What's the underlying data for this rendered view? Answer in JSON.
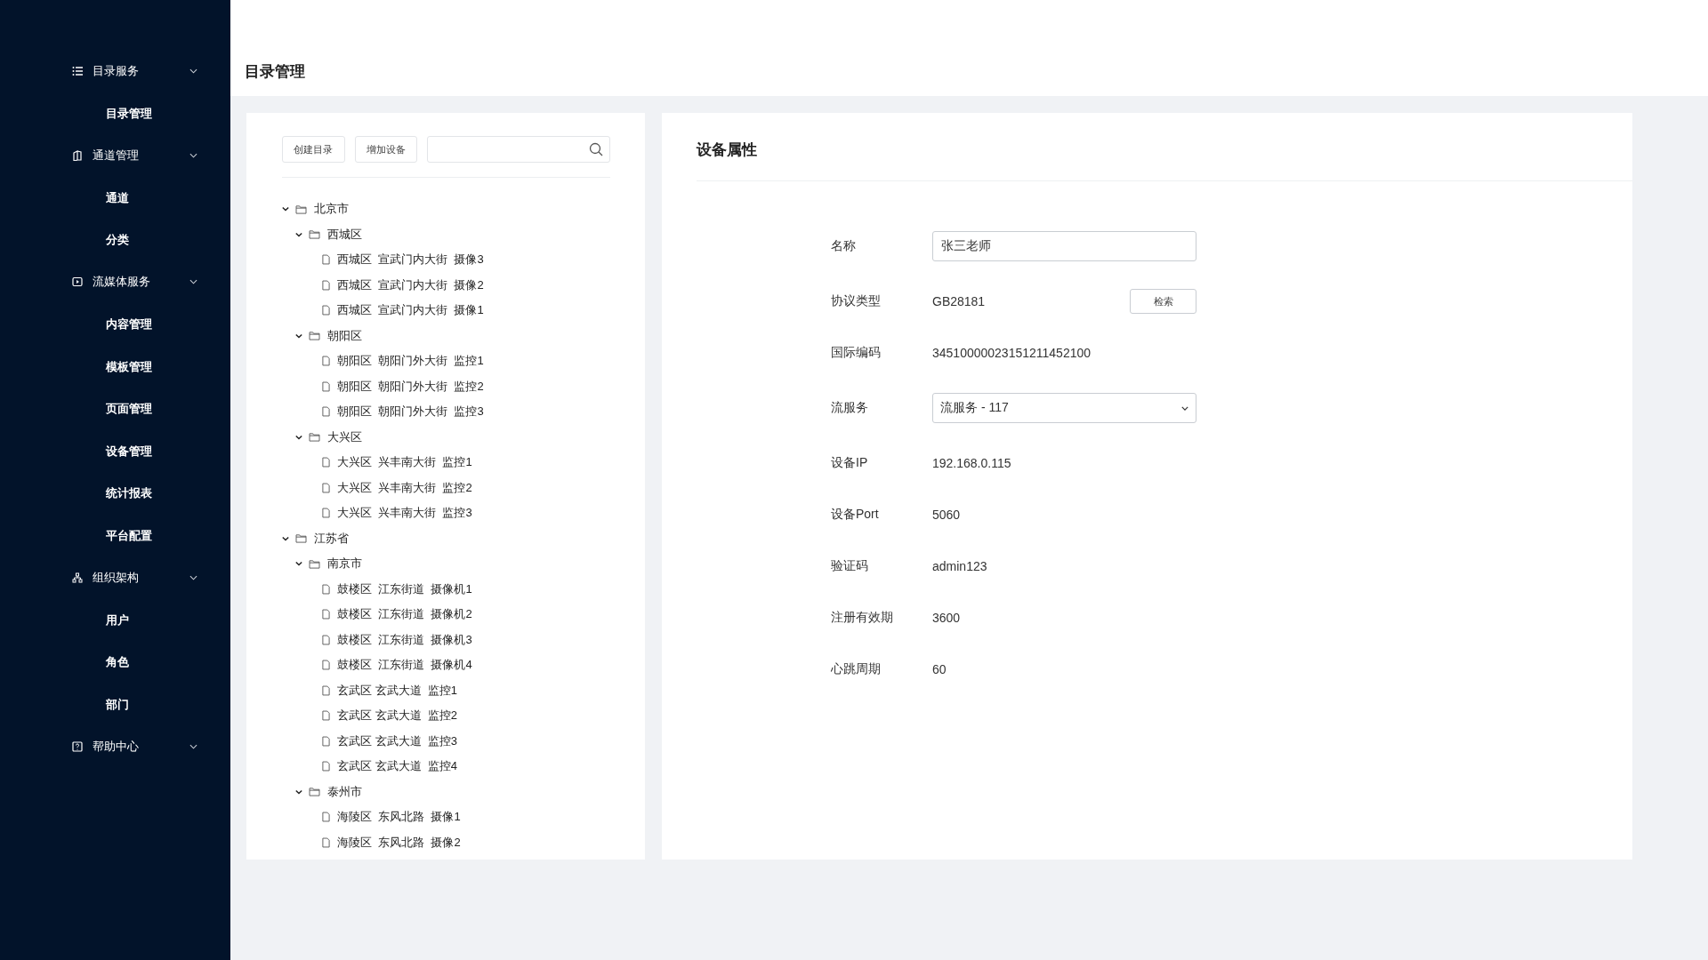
{
  "sidebar": {
    "groups": [
      {
        "label": "目录服务",
        "expanded": true,
        "items": [
          {
            "label": "目录管理"
          }
        ]
      },
      {
        "label": "通道管理",
        "expanded": true,
        "items": [
          {
            "label": "通道"
          },
          {
            "label": "分类"
          }
        ]
      },
      {
        "label": "流媒体服务",
        "expanded": true,
        "items": [
          {
            "label": "内容管理"
          },
          {
            "label": "模板管理"
          },
          {
            "label": "页面管理"
          },
          {
            "label": "设备管理"
          },
          {
            "label": "统计报表"
          },
          {
            "label": "平台配置"
          }
        ]
      },
      {
        "label": "组织架构",
        "expanded": true,
        "items": [
          {
            "label": "用户"
          },
          {
            "label": "角色"
          },
          {
            "label": "部门"
          }
        ]
      },
      {
        "label": "帮助中心",
        "expanded": true
      }
    ]
  },
  "page_title": "目录管理",
  "toolbar": {
    "buttons": [
      "创建目录",
      "增加设备"
    ]
  },
  "tree": [
    {
      "kind": "folder",
      "label": "北京市",
      "expanded": true,
      "children": [
        {
          "kind": "folder",
          "label": "西城区",
          "expanded": true,
          "children": [
            {
              "kind": "file",
              "label": "西城区  宣武门内大街  摄像3"
            },
            {
              "kind": "file",
              "label": "西城区  宣武门内大街  摄像2"
            },
            {
              "kind": "file",
              "label": "西城区  宣武门内大街  摄像1"
            }
          ]
        },
        {
          "kind": "folder",
          "label": "朝阳区",
          "expanded": true,
          "children": [
            {
              "kind": "file",
              "label": "朝阳区  朝阳门外大街  监控1"
            },
            {
              "kind": "file",
              "label": "朝阳区  朝阳门外大街  监控2"
            },
            {
              "kind": "file",
              "label": "朝阳区  朝阳门外大街  监控3"
            }
          ]
        },
        {
          "kind": "folder",
          "label": "大兴区",
          "expanded": true,
          "children": [
            {
              "kind": "file",
              "label": "大兴区  兴丰南大街  监控1"
            },
            {
              "kind": "file",
              "label": "大兴区  兴丰南大街  监控2"
            },
            {
              "kind": "file",
              "label": "大兴区  兴丰南大街  监控3"
            }
          ]
        }
      ]
    },
    {
      "kind": "folder",
      "label": "江苏省",
      "expanded": true,
      "children": [
        {
          "kind": "folder",
          "label": "南京市",
          "expanded": true,
          "children": [
            {
              "kind": "file",
              "label": "鼓楼区  江东街道  摄像机1"
            },
            {
              "kind": "file",
              "label": "鼓楼区  江东街道  摄像机2"
            },
            {
              "kind": "file",
              "label": "鼓楼区  江东街道  摄像机3"
            },
            {
              "kind": "file",
              "label": "鼓楼区  江东街道  摄像机4"
            },
            {
              "kind": "file",
              "label": "玄武区 玄武大道  监控1"
            },
            {
              "kind": "file",
              "label": "玄武区 玄武大道  监控2"
            },
            {
              "kind": "file",
              "label": "玄武区 玄武大道  监控3"
            },
            {
              "kind": "file",
              "label": "玄武区 玄武大道  监控4"
            }
          ]
        },
        {
          "kind": "folder",
          "label": "泰州市",
          "expanded": true,
          "children": [
            {
              "kind": "file",
              "label": "海陵区  东风北路  摄像1"
            },
            {
              "kind": "file",
              "label": "海陵区  东风北路  摄像2"
            }
          ]
        }
      ]
    }
  ],
  "properties": {
    "title": "设备属性",
    "fields": [
      {
        "kind": "input",
        "label": "名称",
        "value": "张三老师"
      },
      {
        "kind": "button",
        "label": "协议类型",
        "value": "GB28181",
        "button": "检索"
      },
      {
        "kind": "text",
        "label": "国际编码",
        "value": "34510000023151211452100"
      },
      {
        "kind": "select",
        "label": "流服务",
        "value": "流服务 - 117"
      },
      {
        "kind": "text",
        "label": "设备IP",
        "value": "192.168.0.115"
      },
      {
        "kind": "text",
        "label": "设备Port",
        "value": "5060"
      },
      {
        "kind": "text",
        "label": "验证码",
        "value": "admin123"
      },
      {
        "kind": "text",
        "label": "注册有效期",
        "value": "3600"
      },
      {
        "kind": "text",
        "label": "心跳周期",
        "value": "60"
      }
    ]
  }
}
